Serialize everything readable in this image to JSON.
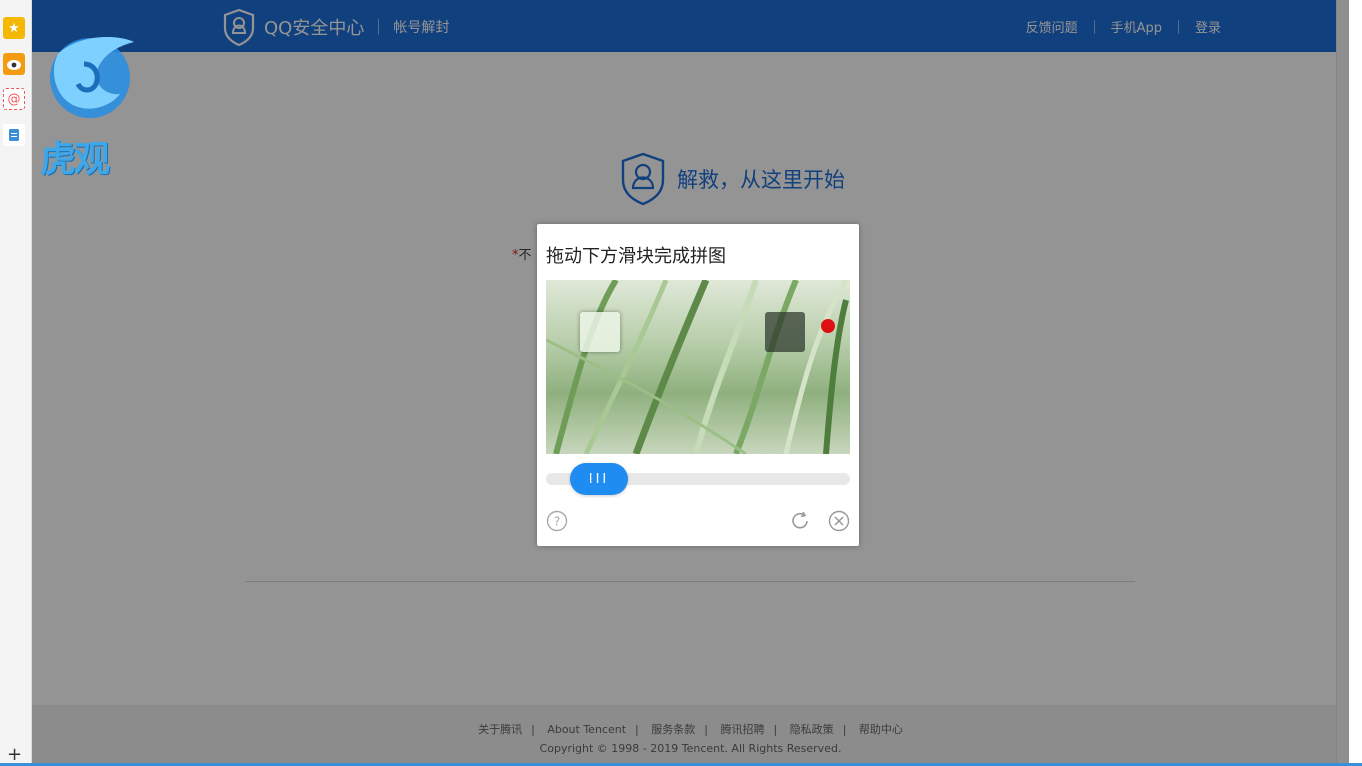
{
  "browser_sidebar": {
    "icons": [
      "star-icon",
      "weibo-icon",
      "mail-icon",
      "document-icon"
    ],
    "add_label": "+"
  },
  "header": {
    "brand_title": "QQ安全中心",
    "brand_sub": "帐号解封",
    "nav": [
      "反馈问题",
      "手机App",
      "登录"
    ],
    "color": "#1e6fd9"
  },
  "hero": {
    "title": "解救，从这里开始"
  },
  "form": {
    "hint_prefix": "*",
    "hint_text": "不"
  },
  "captcha": {
    "title": "拖动下方滑块完成拼图",
    "handle_label": "III",
    "slider_position": 0.12,
    "accent": "#1e8cf0"
  },
  "footer": {
    "links": [
      "关于腾讯",
      "About Tencent",
      "服务条款",
      "腾讯招聘",
      "隐私政策",
      "帮助中心"
    ],
    "copyright": "Copyright © 1998 - 2019 Tencent. All Rights Reserved."
  },
  "watermark": {
    "text": "虎观"
  }
}
